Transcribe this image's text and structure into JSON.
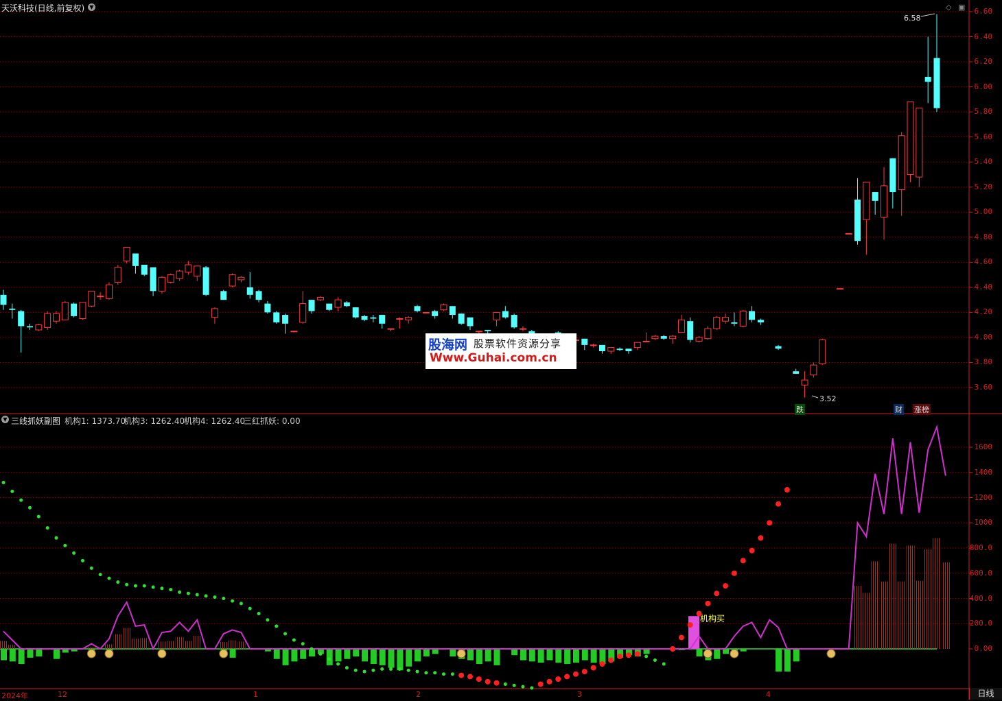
{
  "header": {
    "stock_title": "天沃科技(日线,前复权)",
    "indicator_title": "三线抓妖副图"
  },
  "indicators": [
    {
      "label": "机构1: 1373.70",
      "color": "#e040e0"
    },
    {
      "label": "机构3: 1262.40",
      "color": "#40e040"
    },
    {
      "label": "机构4: 1262.40",
      "color": "#ff3030"
    },
    {
      "label": "三红抓妖: 0.00",
      "color": "#40e040"
    }
  ],
  "price_axis": [
    "6.60",
    "6.40",
    "6.20",
    "6.00",
    "5.80",
    "5.60",
    "5.40",
    "5.20",
    "5.00",
    "4.80",
    "4.60",
    "4.40",
    "4.20",
    "4.00",
    "3.80",
    "3.60"
  ],
  "ind_axis": [
    "1600",
    "1400",
    "1200",
    "1000",
    "800.0",
    "600.0",
    "400.0",
    "200.0",
    "0.00"
  ],
  "x_labels": [
    "2024年",
    "12",
    "1",
    "2",
    "3",
    "4"
  ],
  "annotations": {
    "high": "6.58",
    "low": "3.52",
    "buy_label": "机构买",
    "tags": [
      "跌",
      "财",
      "涨榜"
    ]
  },
  "watermark": {
    "line1": "股海网",
    "line2": "股票软件资源分享",
    "line3": "Www.Guhai.com.cn"
  },
  "period_tab": "日线",
  "colors": {
    "up": "#ff3c3c",
    "down": "#54ffff",
    "grid": "#8b0000",
    "zero": "#2ea02e"
  },
  "chart_data": {
    "type": "candlestick",
    "price_range": [
      3.42,
      6.7
    ],
    "candles": [
      [
        4.34,
        4.26,
        4.38,
        4.22
      ],
      [
        4.23,
        4.22,
        4.27,
        4.15
      ],
      [
        4.21,
        4.09,
        4.22,
        3.88
      ],
      [
        4.09,
        4.08,
        4.11,
        4.06
      ],
      [
        4.06,
        4.1,
        4.11,
        4.05
      ],
      [
        4.08,
        4.19,
        4.21,
        4.06
      ],
      [
        4.13,
        4.19,
        4.21,
        4.11
      ],
      [
        4.14,
        4.28,
        4.29,
        4.14
      ],
      [
        4.27,
        4.17,
        4.28,
        4.16
      ],
      [
        4.15,
        4.28,
        4.28,
        4.14
      ],
      [
        4.25,
        4.37,
        4.37,
        4.24
      ],
      [
        4.33,
        4.33,
        4.36,
        4.3
      ],
      [
        4.31,
        4.42,
        4.44,
        4.3
      ],
      [
        4.44,
        4.56,
        4.58,
        4.42
      ],
      [
        4.61,
        4.72,
        4.72,
        4.59
      ],
      [
        4.67,
        4.57,
        4.67,
        4.51
      ],
      [
        4.58,
        4.5,
        4.58,
        4.49
      ],
      [
        4.56,
        4.37,
        4.56,
        4.33
      ],
      [
        4.37,
        4.48,
        4.49,
        4.35
      ],
      [
        4.44,
        4.5,
        4.51,
        4.43
      ],
      [
        4.47,
        4.53,
        4.54,
        4.45
      ],
      [
        4.52,
        4.58,
        4.61,
        4.5
      ],
      [
        4.49,
        4.57,
        4.57,
        4.45
      ],
      [
        4.56,
        4.34,
        4.57,
        4.33
      ],
      [
        4.16,
        4.23,
        4.24,
        4.11
      ],
      [
        4.37,
        4.3,
        4.38,
        4.31
      ],
      [
        4.41,
        4.5,
        4.51,
        4.4
      ],
      [
        4.46,
        4.48,
        4.49,
        4.44
      ],
      [
        4.4,
        4.34,
        4.52,
        4.31
      ],
      [
        4.37,
        4.3,
        4.38,
        4.28
      ],
      [
        4.27,
        4.2,
        4.29,
        4.19
      ],
      [
        4.2,
        4.12,
        4.21,
        4.11
      ],
      [
        4.18,
        4.11,
        4.19,
        4.03
      ],
      [
        4.05,
        4.05,
        4.05,
        4.04
      ],
      [
        4.12,
        4.27,
        4.37,
        4.11
      ],
      [
        4.3,
        4.21,
        4.3,
        4.19
      ],
      [
        4.3,
        4.32,
        4.33,
        4.29
      ],
      [
        4.27,
        4.22,
        4.27,
        4.21
      ],
      [
        4.24,
        4.3,
        4.32,
        4.21
      ],
      [
        4.28,
        4.25,
        4.29,
        4.24
      ],
      [
        4.24,
        4.16,
        4.24,
        4.15
      ],
      [
        4.17,
        4.14,
        4.18,
        4.13
      ],
      [
        4.16,
        4.15,
        4.18,
        4.12
      ],
      [
        4.18,
        4.11,
        4.18,
        4.07
      ],
      [
        4.07,
        4.07,
        4.07,
        4.05
      ],
      [
        4.15,
        4.15,
        4.16,
        4.07
      ],
      [
        4.14,
        4.16,
        4.17,
        4.11
      ],
      [
        4.25,
        4.21,
        4.26,
        4.2
      ],
      [
        4.2,
        4.2,
        4.2,
        4.19
      ],
      [
        4.21,
        4.17,
        4.22,
        4.15
      ],
      [
        4.22,
        4.26,
        4.27,
        4.21
      ],
      [
        4.25,
        4.18,
        4.25,
        4.15
      ],
      [
        4.19,
        4.11,
        4.19,
        4.1
      ],
      [
        4.16,
        4.09,
        4.16,
        4.06
      ],
      [
        4.05,
        4.05,
        4.05,
        4.02
      ],
      [
        4.06,
        4.05,
        4.06,
        4.03
      ],
      [
        4.14,
        4.2,
        4.2,
        4.09
      ],
      [
        4.21,
        4.16,
        4.25,
        4.15
      ],
      [
        4.18,
        4.08,
        4.19,
        4.07
      ],
      [
        4.07,
        4.07,
        4.09,
        4.05
      ],
      [
        4.05,
        4.03,
        4.06,
        4.01
      ],
      [
        4.0,
        4.0,
        4.0,
        4.0
      ],
      [
        3.99,
        4.02,
        4.03,
        3.98
      ],
      [
        4.04,
        4.0,
        4.05,
        3.98
      ],
      [
        4.02,
        3.97,
        4.02,
        3.96
      ],
      [
        3.98,
        3.98,
        3.98,
        3.96
      ],
      [
        3.99,
        3.94,
        3.99,
        3.9
      ],
      [
        3.94,
        3.94,
        3.95,
        3.92
      ],
      [
        3.94,
        3.89,
        3.94,
        3.87
      ],
      [
        3.89,
        3.92,
        3.92,
        3.87
      ],
      [
        3.91,
        3.9,
        3.92,
        3.89
      ],
      [
        3.91,
        3.89,
        3.91,
        3.87
      ],
      [
        3.92,
        3.96,
        3.96,
        3.9
      ],
      [
        3.97,
        3.97,
        4.04,
        3.97
      ],
      [
        3.99,
        4.01,
        4.02,
        3.98
      ],
      [
        4.01,
        3.99,
        4.02,
        3.98
      ],
      [
        3.99,
        4.01,
        4.02,
        3.95
      ],
      [
        4.04,
        4.14,
        4.18,
        4.04
      ],
      [
        4.13,
        3.98,
        4.16,
        3.96
      ],
      [
        3.97,
        4.0,
        4.01,
        3.96
      ],
      [
        3.99,
        4.07,
        4.09,
        3.98
      ],
      [
        4.07,
        4.16,
        4.17,
        4.06
      ],
      [
        4.13,
        4.16,
        4.19,
        4.11
      ],
      [
        4.12,
        4.11,
        4.2,
        4.09
      ],
      [
        4.09,
        4.21,
        4.22,
        4.08
      ],
      [
        4.21,
        4.14,
        4.25,
        4.12
      ],
      [
        4.14,
        4.12,
        4.15,
        4.1
      ],
      [
        null,
        null,
        null,
        null
      ],
      [
        3.93,
        3.91,
        3.94,
        3.9
      ],
      [
        null,
        null,
        null,
        null
      ],
      [
        3.73,
        3.71,
        3.75,
        3.71
      ],
      [
        3.62,
        3.66,
        3.73,
        3.52
      ],
      [
        3.7,
        3.78,
        3.8,
        3.68
      ],
      [
        3.79,
        3.98,
        3.99,
        3.78
      ],
      [
        null,
        null,
        null,
        null
      ],
      [
        4.39,
        4.39,
        4.39,
        4.39
      ],
      [
        4.83,
        4.83,
        4.83,
        4.83
      ],
      [
        5.1,
        4.77,
        5.27,
        4.74
      ],
      [
        4.94,
        5.24,
        5.24,
        4.66
      ],
      [
        5.16,
        5.09,
        5.16,
        4.98
      ],
      [
        4.96,
        5.21,
        5.36,
        4.78
      ],
      [
        5.43,
        5.16,
        5.43,
        5.03
      ],
      [
        5.18,
        5.61,
        5.64,
        4.97
      ],
      [
        5.3,
        5.88,
        5.88,
        5.24
      ],
      [
        5.28,
        5.83,
        5.83,
        5.2
      ],
      [
        6.08,
        6.04,
        6.4,
        5.87
      ],
      [
        6.23,
        5.83,
        6.58,
        5.8
      ]
    ],
    "purple_line": [
      139,
      70,
      0,
      0,
      0,
      0,
      0,
      0,
      0,
      0,
      40,
      0,
      80,
      260,
      370,
      180,
      190,
      0,
      130,
      140,
      210,
      140,
      230,
      0,
      0,
      120,
      150,
      130,
      0,
      0,
      0,
      0,
      0,
      0,
      0,
      0,
      0,
      0,
      0,
      0,
      0,
      0,
      0,
      0,
      0,
      0,
      0,
      0,
      0,
      0,
      0,
      0,
      0,
      0,
      0,
      0,
      0,
      0,
      0,
      0,
      0,
      0,
      0,
      0,
      0,
      0,
      0,
      0,
      0,
      0,
      0,
      0,
      0,
      0,
      0,
      0,
      0,
      0,
      0,
      100,
      0,
      0,
      0,
      100,
      180,
      210,
      90,
      230,
      170,
      0,
      0,
      0,
      0,
      0,
      0,
      0,
      0,
      1000,
      890,
      1390,
      1070,
      1670,
      1070,
      1640,
      1080,
      1580,
      1760,
      1373.7
    ],
    "green_bars": [
      -90,
      -100,
      -120,
      -70,
      -60,
      0,
      -80,
      -30,
      -20,
      0,
      -25,
      0,
      -50,
      0,
      0,
      0,
      0,
      0,
      0,
      0,
      0,
      0,
      0,
      0,
      0,
      -30,
      -70,
      0,
      0,
      0,
      -20,
      -80,
      -130,
      -100,
      -80,
      -60,
      -40,
      -130,
      -100,
      -80,
      -60,
      -100,
      -120,
      -130,
      -150,
      -170,
      -140,
      -100,
      -60,
      -40,
      0,
      -60,
      -80,
      -90,
      -120,
      -100,
      -130,
      0,
      -50,
      -90,
      -100,
      -110,
      -90,
      -110,
      -120,
      -110,
      -90,
      -110,
      -120,
      -100,
      -70,
      -50,
      -60,
      -40,
      0,
      0,
      0,
      -10,
      0,
      -60,
      -90,
      -80,
      -40,
      -30,
      -20,
      0,
      0,
      0,
      -180,
      -180,
      -100,
      0,
      0,
      0,
      0,
      0,
      0,
      0,
      0,
      0,
      0,
      0,
      0,
      0,
      0,
      0,
      0,
      0
    ],
    "red_bars": [
      0,
      0,
      0,
      0,
      0,
      0,
      0,
      0,
      0,
      0,
      0,
      0,
      0,
      0,
      0,
      0,
      0,
      0,
      0,
      0,
      0,
      0,
      0,
      0,
      0,
      0,
      0,
      0,
      0,
      0,
      0,
      0,
      0,
      0,
      0,
      0,
      0,
      0,
      0,
      0,
      0,
      0,
      0,
      0,
      0,
      0,
      0,
      0,
      0,
      0,
      0,
      0,
      0,
      0,
      0,
      0,
      0,
      0,
      0,
      0,
      0,
      0,
      0,
      0,
      0,
      0,
      0,
      0,
      0,
      0,
      0,
      0,
      0,
      0,
      0,
      0,
      0,
      0,
      0,
      0,
      0,
      0,
      0,
      0,
      0,
      0,
      0,
      0,
      0,
      0,
      0,
      0,
      0,
      0,
      0,
      0,
      0,
      0,
      0,
      0,
      0,
      0,
      0,
      0,
      0,
      0,
      0,
      0,
      0,
      0,
      0,
      0
    ],
    "dot_line": [
      1320,
      1250,
      1180,
      1120,
      1050,
      960,
      880,
      820,
      760,
      700,
      640,
      590,
      560,
      530,
      510,
      500,
      500,
      490,
      480,
      470,
      450,
      440,
      430,
      420,
      410,
      400,
      380,
      360,
      320,
      280,
      230,
      180,
      120,
      70,
      40,
      0,
      -40,
      -80,
      -120,
      -150,
      -170,
      -180,
      -170,
      -160,
      -160,
      -160,
      -170,
      -180,
      -190,
      -190,
      -200,
      -200,
      -210,
      -220,
      -240,
      -260,
      -270,
      -280,
      -290,
      -300,
      -310,
      -280,
      -260,
      -240,
      -220,
      -200,
      -180,
      -150,
      -120,
      -90,
      -60,
      -50,
      -40,
      -60,
      -90,
      -120,
      0,
      90,
      190,
      280,
      360,
      440,
      500,
      600,
      700,
      780,
      880,
      1000,
      1150,
      1262.4
    ]
  }
}
